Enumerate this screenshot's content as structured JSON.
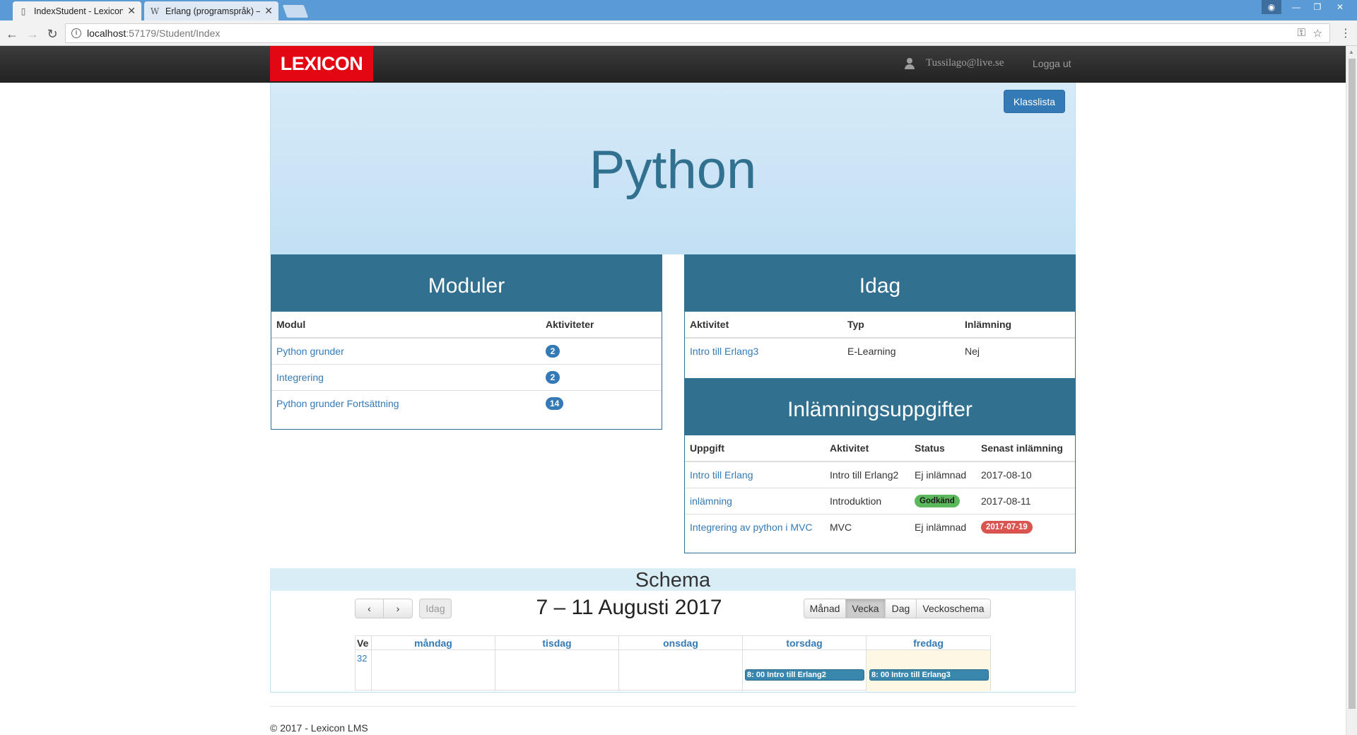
{
  "browser": {
    "tabs": [
      {
        "title": "IndexStudent - Lexicon L",
        "close": "✕"
      },
      {
        "title": "Erlang (programspråk) –",
        "close": "✕"
      }
    ],
    "url_host": "localhost",
    "url_path": ":57179/Student/Index"
  },
  "navbar": {
    "logo": "LEXICON",
    "user_email": "Tussilago@live.se",
    "logout": "Logga ut"
  },
  "header": {
    "title": "Python",
    "klasslista": "Klasslista"
  },
  "moduler": {
    "title": "Moduler",
    "columns": [
      "Modul",
      "Aktiviteter"
    ],
    "rows": [
      {
        "name": "Python grunder",
        "count": "2"
      },
      {
        "name": "Integrering",
        "count": "2"
      },
      {
        "name": "Python grunder Fortsättning",
        "count": "14"
      }
    ]
  },
  "idag": {
    "title": "Idag",
    "columns": [
      "Aktivitet",
      "Typ",
      "Inlämning"
    ],
    "rows": [
      {
        "aktivitet": "Intro till Erlang3",
        "typ": "E-Learning",
        "inlamning": "Nej"
      }
    ]
  },
  "inlamning": {
    "title": "Inlämningsuppgifter",
    "columns": [
      "Uppgift",
      "Aktivitet",
      "Status",
      "Senast inlämning"
    ],
    "rows": [
      {
        "uppgift": "Intro till Erlang",
        "aktivitet": "Intro till Erlang2",
        "status": "Ej inlämnad",
        "senast": "2017-08-10"
      },
      {
        "uppgift": "inlämning",
        "aktivitet": "Introduktion",
        "status": "Godkänd",
        "senast": "2017-08-11"
      },
      {
        "uppgift": "Integrering av python i MVC",
        "aktivitet": "MVC",
        "status": "Ej inlämnad",
        "senast": "2017-07-19"
      }
    ]
  },
  "schema": {
    "title": "Schema",
    "prev": "‹",
    "next": "›",
    "today": "Idag",
    "range_title": "7 – 11 Augusti 2017",
    "views": [
      "Månad",
      "Vecka",
      "Dag",
      "Veckoschema"
    ],
    "active_view": "Vecka",
    "week_label": "Ve",
    "week_number": "32",
    "days": [
      "måndag",
      "tisdag",
      "onsdag",
      "torsdag",
      "fredag"
    ],
    "events": [
      {
        "day": "torsdag",
        "text": "8: 00 Intro till Erlang2"
      },
      {
        "day": "fredag",
        "text": "8: 00 Intro till Erlang3"
      }
    ]
  },
  "footer": "© 2017 - Lexicon LMS",
  "colors": {
    "primary": "#337ab7",
    "panel": "#31708f",
    "logo_red": "#e30613",
    "success": "#5cb85c",
    "danger": "#d9534f"
  }
}
